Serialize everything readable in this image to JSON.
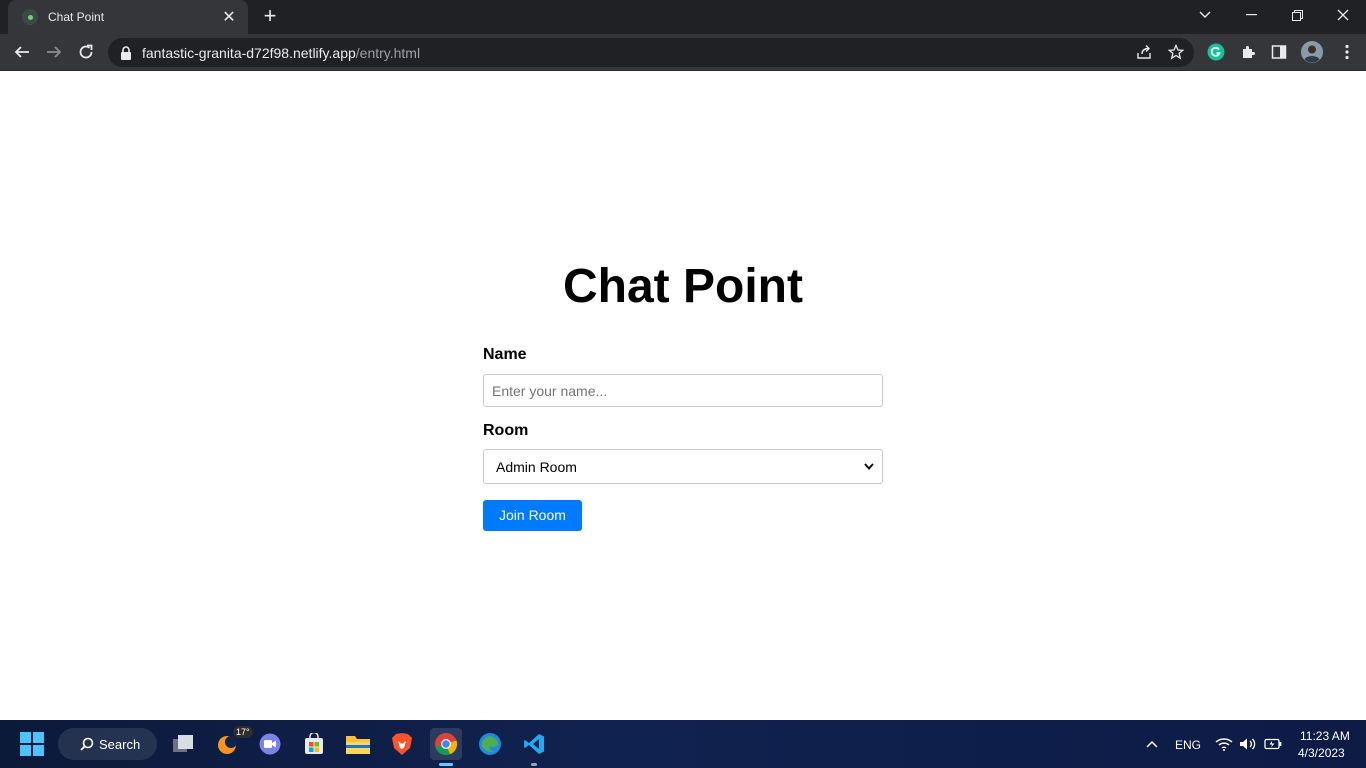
{
  "browser": {
    "tab_title": "Chat Point",
    "url_host": "fantastic-granita-d72f98.netlify.app",
    "url_path": "/entry.html"
  },
  "page": {
    "title": "Chat Point",
    "name_label": "Name",
    "name_placeholder": "Enter your name...",
    "room_label": "Room",
    "room_selected": "Admin Room",
    "join_button": "Join Room"
  },
  "taskbar": {
    "search_label": "Search",
    "weather_temp": "17°",
    "language": "ENG",
    "time": "11:23 AM",
    "date": "4/3/2023"
  },
  "colors": {
    "accent": "#007bff",
    "browser_dark": "#202124",
    "browser_toolbar": "#35363a"
  }
}
